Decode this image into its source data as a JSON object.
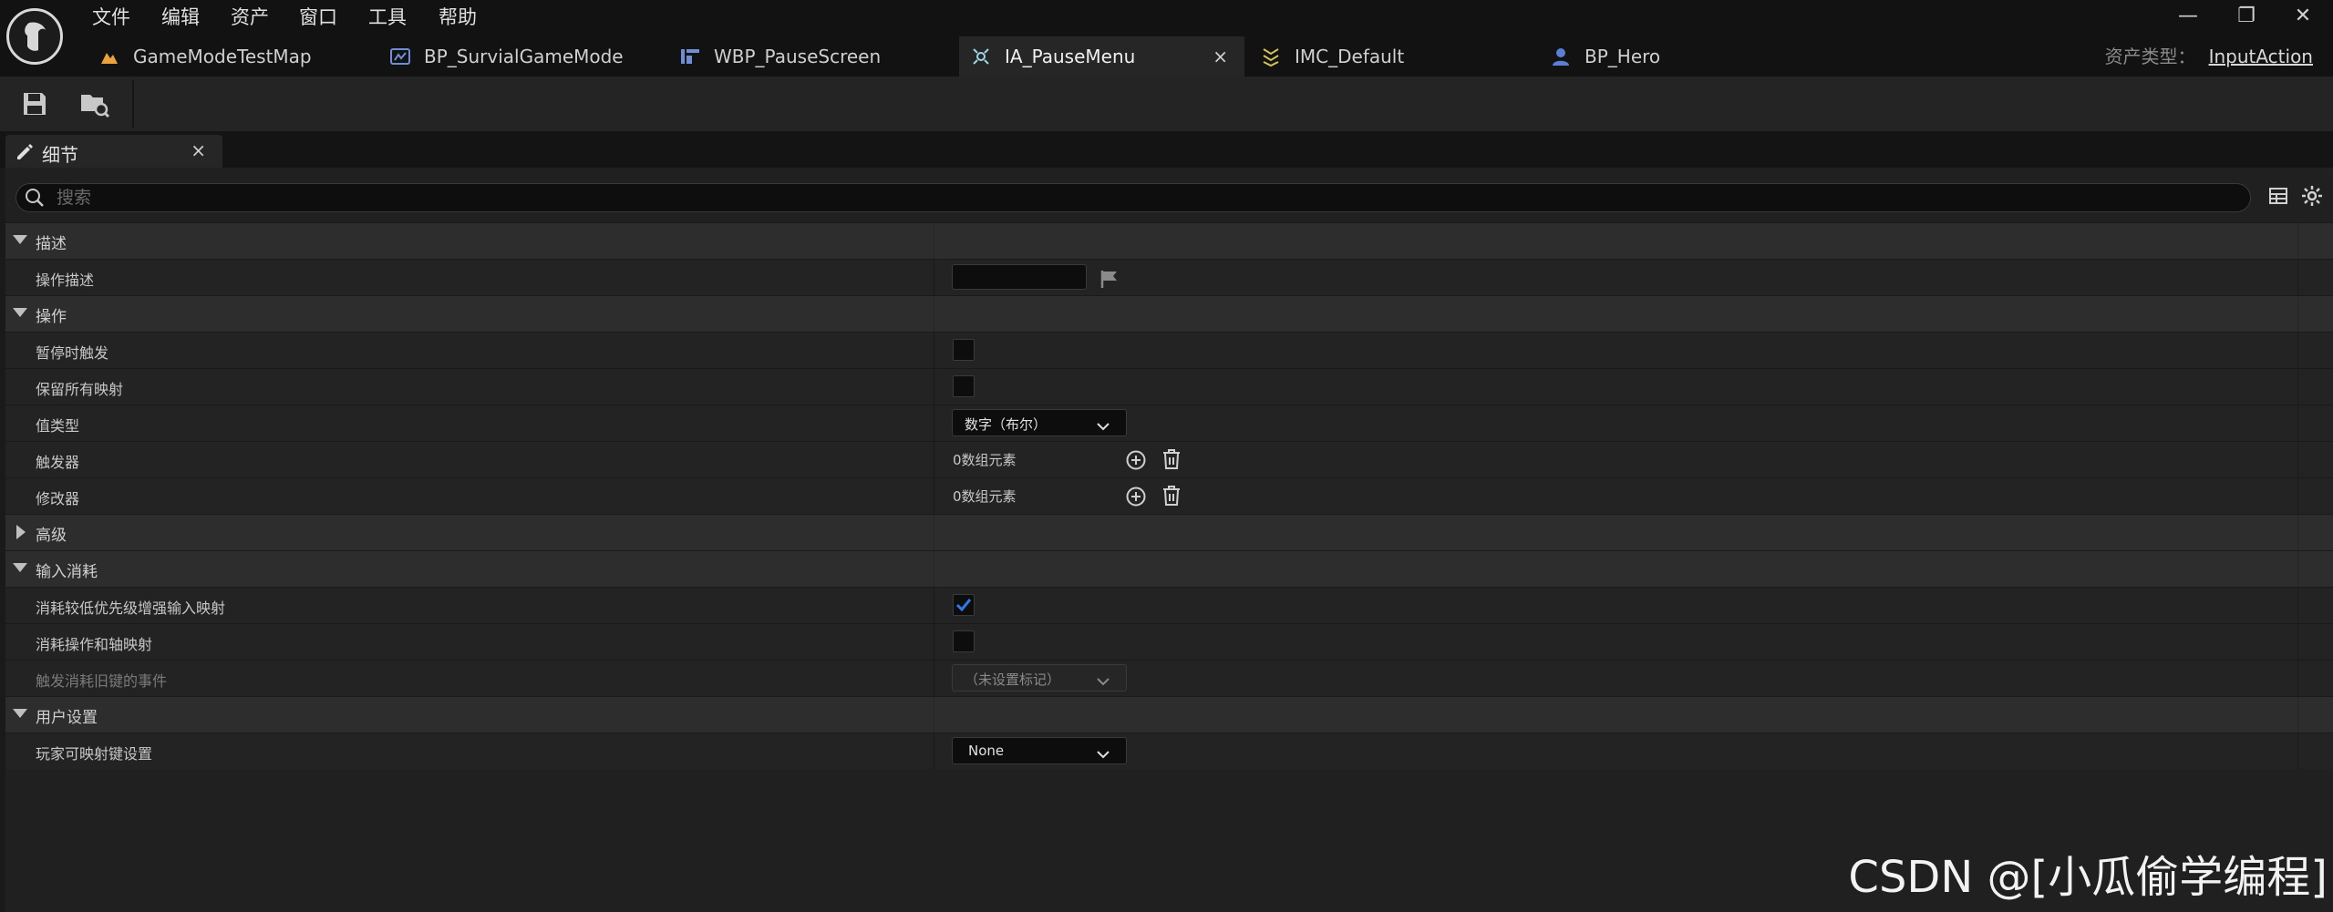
{
  "menu": [
    "文件",
    "编辑",
    "资产",
    "窗口",
    "工具",
    "帮助"
  ],
  "tabs": [
    {
      "label": "GameModeTestMap",
      "icon": "level-icon"
    },
    {
      "label": "BP_SurvialGameMode",
      "icon": "blueprint-icon"
    },
    {
      "label": "WBP_PauseScreen",
      "icon": "widget-blueprint-icon"
    },
    {
      "label": "IA_PauseMenu",
      "icon": "input-action-icon",
      "active": true,
      "close": "×"
    },
    {
      "label": "IMC_Default",
      "icon": "input-mapping-icon"
    },
    {
      "label": "BP_Hero",
      "icon": "character-icon"
    }
  ],
  "asset_type": {
    "label": "资产类型：",
    "value": "InputAction"
  },
  "window_controls": {
    "minimize": "—",
    "restore": "❐",
    "close": "✕"
  },
  "toolbar": {
    "save": "save-icon",
    "browse": "browse-asset-icon"
  },
  "details_tab": {
    "label": "细节",
    "close": "×"
  },
  "search": {
    "placeholder": "搜索"
  },
  "sections": {
    "description": {
      "title": "描述",
      "action_description": {
        "label": "操作描述",
        "value": ""
      }
    },
    "action": {
      "title": "操作",
      "trigger_when_paused": {
        "label": "暂停时触发",
        "checked": false
      },
      "reserve_all_mappings": {
        "label": "保留所有映射",
        "checked": false
      },
      "value_type": {
        "label": "值类型",
        "value": "数字（布尔）"
      },
      "triggers": {
        "label": "触发器",
        "value": "0数组元素"
      },
      "modifiers": {
        "label": "修改器",
        "value": "0数组元素"
      }
    },
    "advanced": {
      "title": "高级"
    },
    "input_consumption": {
      "title": "输入消耗",
      "consume_lower_priority": {
        "label": "消耗较低优先级增强输入映射",
        "checked": true
      },
      "consume_action_axis": {
        "label": "消耗操作和轴映射",
        "checked": false
      },
      "trigger_events_consumed": {
        "label": "触发消耗旧键的事件",
        "value": "（未设置标记）"
      }
    },
    "user_settings": {
      "title": "用户设置",
      "player_mappable_key_settings": {
        "label": "玩家可映射键设置",
        "value": "None"
      }
    }
  },
  "colors": {
    "accent": "#2f7ae5",
    "background": "#1a1a1a",
    "category": "#2d2d2d",
    "row": "#232323"
  },
  "watermark": "CSDN @[小瓜偷学编程]"
}
